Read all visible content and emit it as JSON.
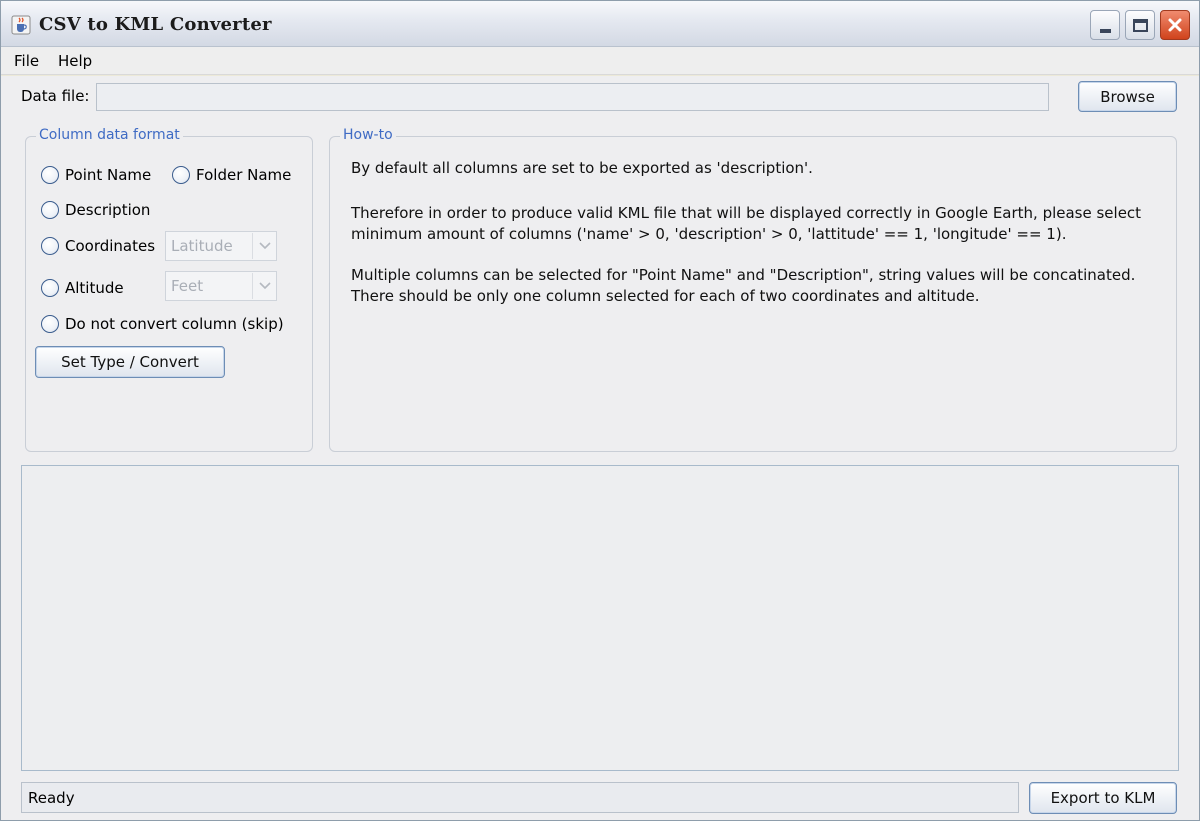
{
  "window": {
    "title": "CSV to KML Converter"
  },
  "menu": {
    "items": [
      "File",
      "Help"
    ]
  },
  "datafile": {
    "label": "Data file:",
    "value": "",
    "browse_label": "Browse"
  },
  "column_format": {
    "title": "Column data format",
    "point_name": "Point Name",
    "folder_name": "Folder Name",
    "description": "Description",
    "coordinates": "Coordinates",
    "coordinates_combo": "Latitude",
    "altitude": "Altitude",
    "altitude_combo": "Feet",
    "skip": "Do not convert column (skip)",
    "set_type_label": "Set Type / Convert"
  },
  "howto": {
    "title": "How-to",
    "line1": "By default all columns are set to be exported as 'description'.",
    "line2": "Therefore in order to produce valid KML file that will be displayed correctly in Google Earth, please select",
    "line3": "minimum amount of columns ('name' > 0, 'description' > 0, 'lattitude' == 1, 'longitude' == 1).",
    "line4": "Multiple columns can be selected for \"Point Name\" and \"Description\", string values will be concatinated.",
    "line5": "There should be only one column selected for each of two coordinates and altitude."
  },
  "status": {
    "text": "Ready",
    "export_label": "Export to KLM"
  },
  "icons": {
    "app": "java-cup-icon",
    "minimize": "minimize-icon",
    "maximize": "maximize-icon",
    "close": "close-icon"
  }
}
